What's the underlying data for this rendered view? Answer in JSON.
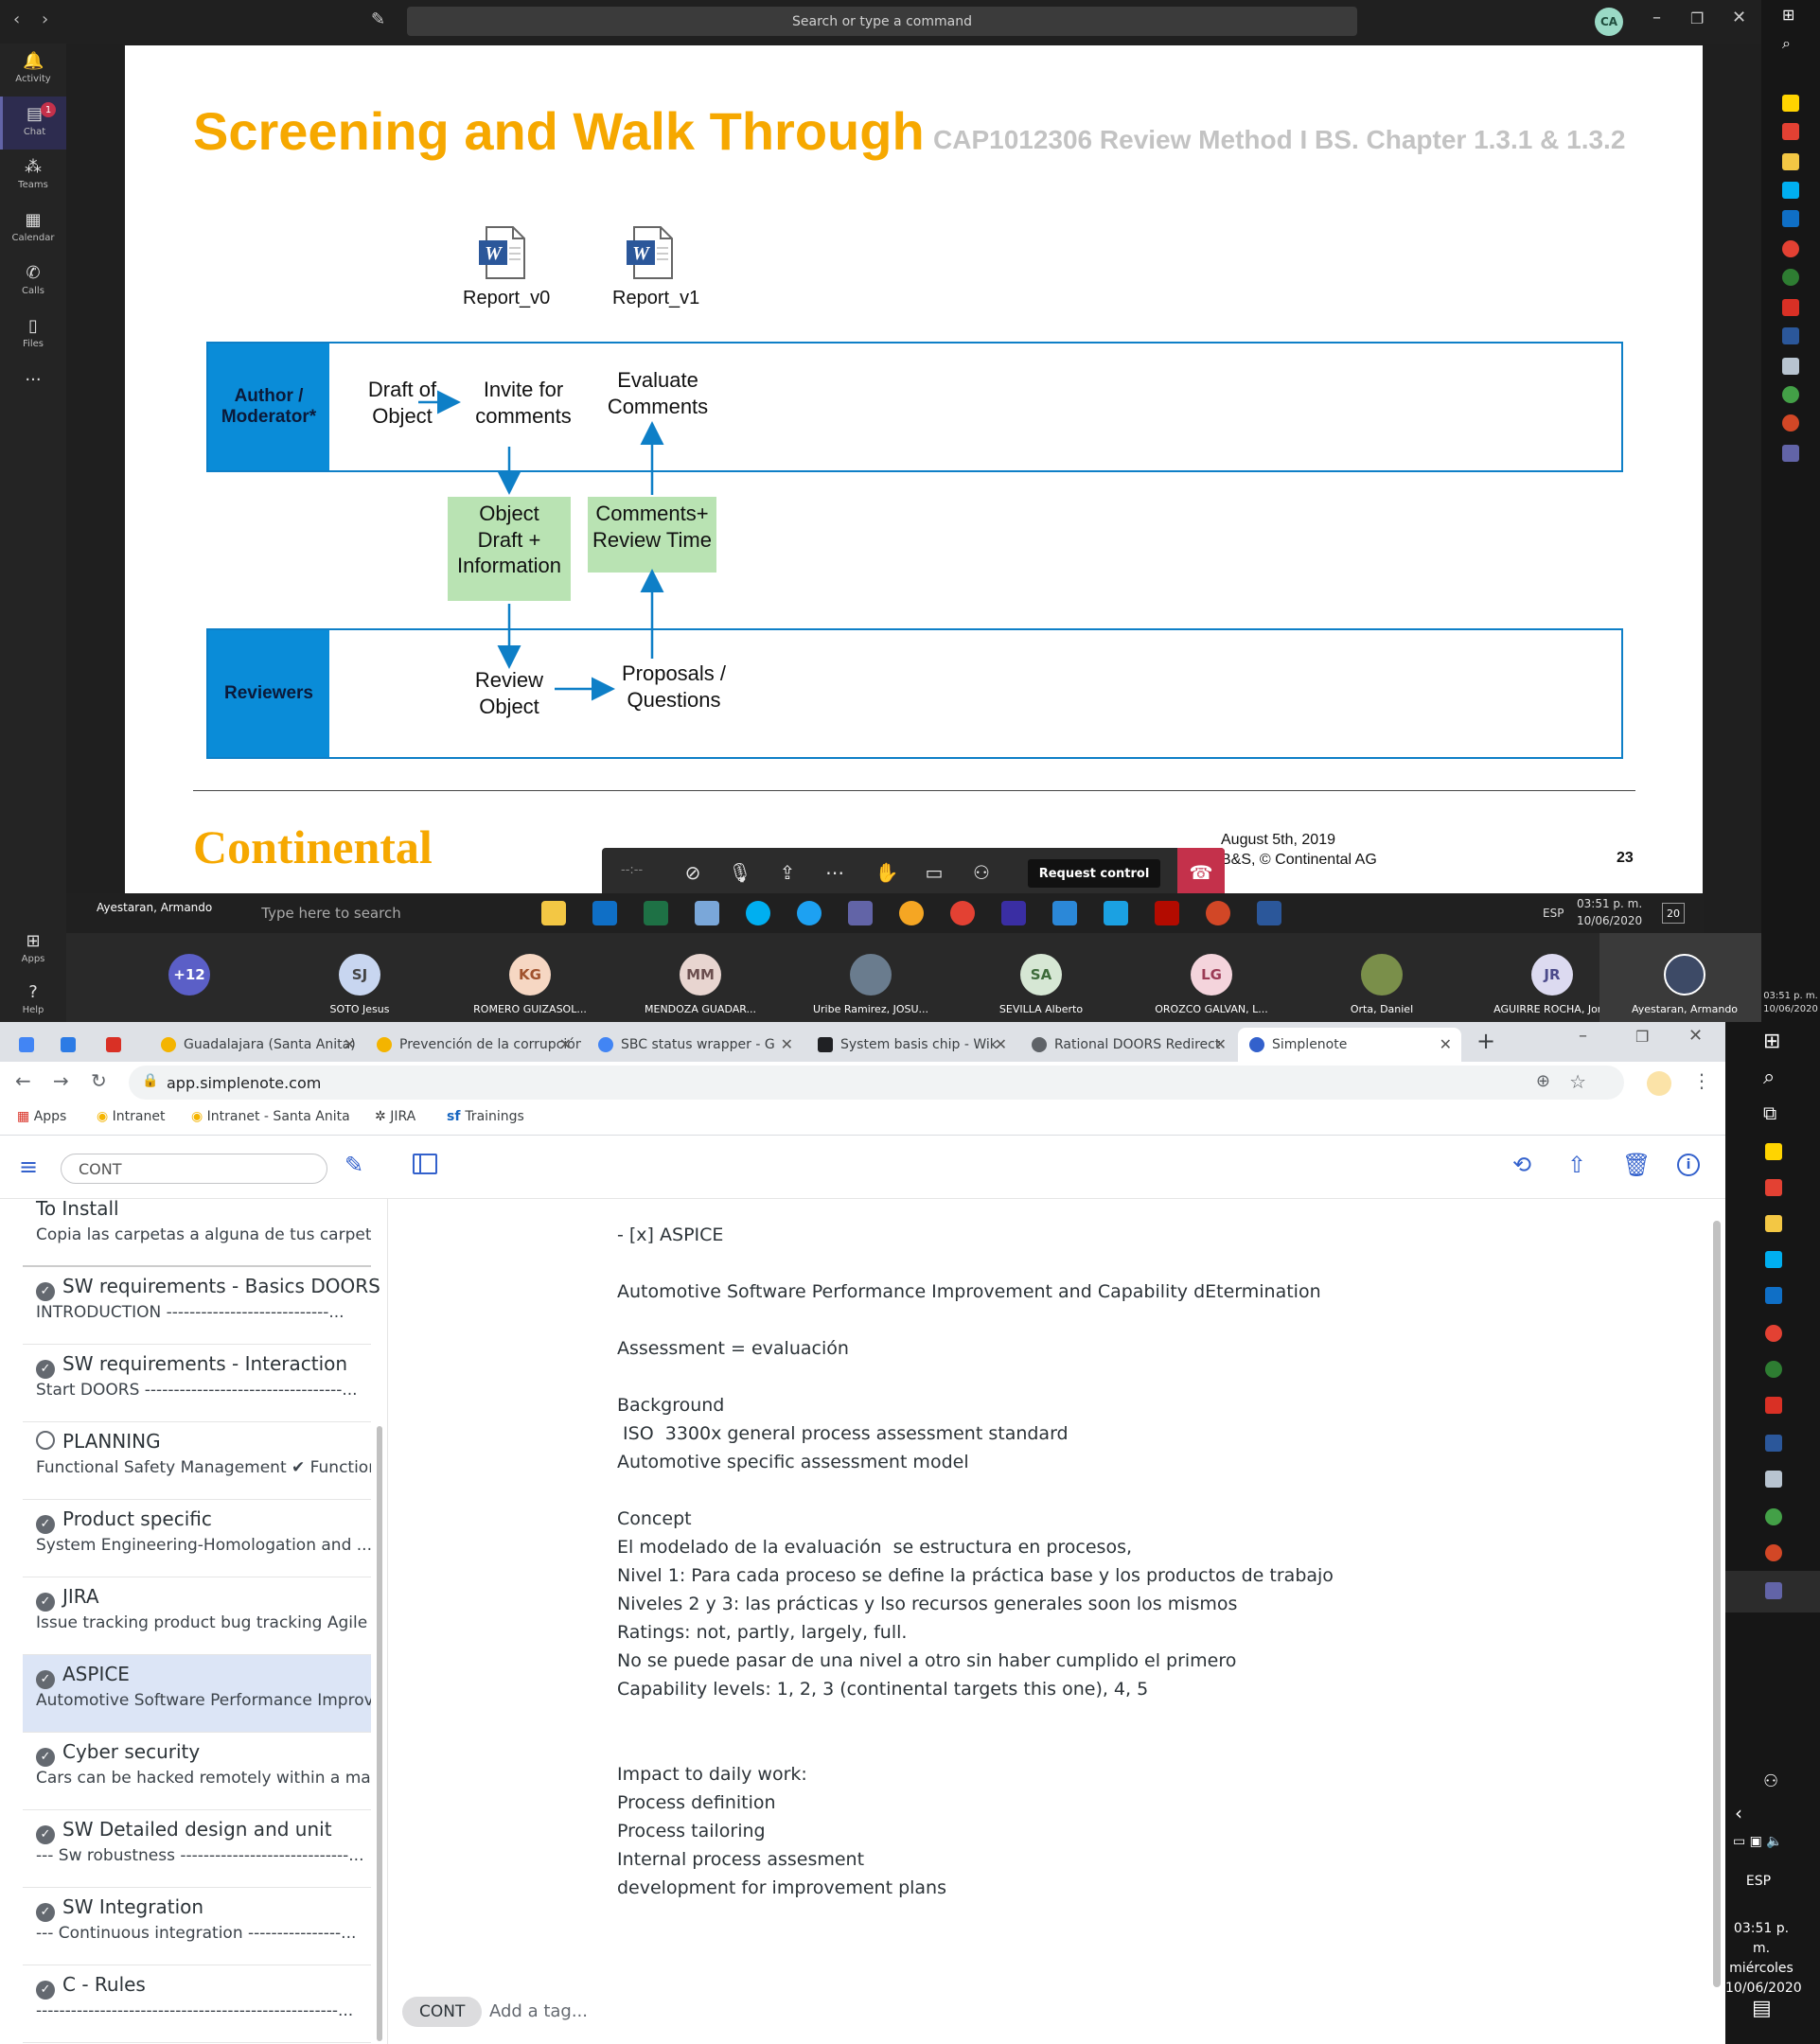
{
  "teams": {
    "search_placeholder": "Search or type a command",
    "user_initials": "CA",
    "rail": [
      {
        "label": "Activity",
        "icon": "bell-icon"
      },
      {
        "label": "Chat",
        "icon": "chat-icon",
        "badge": "1"
      },
      {
        "label": "Teams",
        "icon": "teams-icon"
      },
      {
        "label": "Calendar",
        "icon": "calendar-icon"
      },
      {
        "label": "Calls",
        "icon": "phone-icon"
      },
      {
        "label": "Files",
        "icon": "file-icon"
      },
      {
        "label": "...",
        "icon": "more-icon"
      }
    ],
    "rail_bottom": [
      {
        "label": "Apps",
        "icon": "apps-icon"
      },
      {
        "label": "Help",
        "icon": "help-icon"
      }
    ],
    "call_controls": {
      "timer": "--:--",
      "request_control": "Request control"
    },
    "participants": [
      {
        "initials": "+12",
        "name": "",
        "color": "#5b5fc7"
      },
      {
        "initials": "SJ",
        "name": "SOTO Jesus",
        "color": "#c8d6f0"
      },
      {
        "initials": "KG",
        "name": "ROMERO GUIZASOL...",
        "color": "#f6d7c3"
      },
      {
        "initials": "MM",
        "name": "MENDOZA GUADAR...",
        "color": "#e8d5d0"
      },
      {
        "initials": "",
        "name": "Uribe Ramirez, JOSU...",
        "color": "#6a7c8e"
      },
      {
        "initials": "SA",
        "name": "SEVILLA Alberto",
        "color": "#d6e7d4"
      },
      {
        "initials": "LG",
        "name": "OROZCO GALVAN, L...",
        "color": "#f4d4dc"
      },
      {
        "initials": "",
        "name": "Orta, Daniel",
        "color": "#7a8f4a"
      },
      {
        "initials": "JR",
        "name": "AGUIRRE ROCHA, Jor...",
        "color": "#dcdaf0"
      },
      {
        "initials": "",
        "name": "Ayestaran, Armando",
        "color": "#3d4a66"
      }
    ]
  },
  "slide": {
    "title": "Screening and Walk Through",
    "subtitle": "CAP1012306 Review Method I BS. Chapter 1.3.1 & 1.3.2",
    "docs": [
      "Report_v0",
      "Report_v1"
    ],
    "lane_author": "Author / Moderator*",
    "lane_reviewers": "Reviewers",
    "nodes": {
      "draft": "Draft of\nObject",
      "invite": "Invite for\ncomments",
      "evaluate": "Evaluate\nComments",
      "object_draft": "Object\nDraft +\nInformation",
      "comments_time": "Comments+\nReview Time",
      "review": "Review\nObject",
      "proposals": "Proposals /\nQuestions"
    },
    "logo": "Continental",
    "footer_date": "August 5th, 2019",
    "footer_copy": "B&S, © Continental AG",
    "page": "23"
  },
  "remote_taskbar": {
    "user_label": "Ayestaran, Armando",
    "search_placeholder": "Type here to search",
    "lang": "ESP",
    "time": "03:51 p. m.",
    "date": "10/06/2020",
    "notif": "20"
  },
  "local_tray": {
    "time_top": "03:51 p. m.",
    "date_top": "10/06/2020",
    "lang": "ESP",
    "time": "03:51 p. m.",
    "day": "miércoles",
    "date": "10/06/2020"
  },
  "chrome": {
    "tabs": [
      {
        "title": "",
        "color": "#4285f4"
      },
      {
        "title": "",
        "color": "#2c7be5"
      },
      {
        "title": "",
        "color": "#d93025"
      },
      {
        "title": "Guadalajara (Santa Anita)",
        "color": "#f4b400"
      },
      {
        "title": "Prevención de la corrupción",
        "color": "#f4b400"
      },
      {
        "title": "SBC status wrapper - G",
        "color": "#4285f4"
      },
      {
        "title": "System basis chip - Wik",
        "color": "#202124"
      },
      {
        "title": "Rational DOORS Redirect",
        "color": "#5f6368"
      },
      {
        "title": "Simplenote",
        "color": "#3361cc"
      }
    ],
    "url": "app.simplenote.com",
    "bookmarks": [
      "Apps",
      "Intranet",
      "Intranet - Santa Anita",
      "JIRA",
      "Trainings"
    ]
  },
  "simplenote": {
    "search_value": "CONT",
    "notes": [
      {
        "title": "To Install",
        "preview": "Copia las carpetas a alguna de tus carpetas. ...",
        "check": "none"
      },
      {
        "title": "SW requirements - Basics DOORS",
        "preview": "INTRODUCTION ----------------------------...",
        "check": "done"
      },
      {
        "title": "SW requirements - Interaction",
        "preview": "Start DOORS ----------------------------------...",
        "check": "done"
      },
      {
        "title": "PLANNING",
        "preview": "Functional Safety Management  ✔ Function...",
        "check": "open"
      },
      {
        "title": "Product specific",
        "preview": "System Engineering-Homologation and ...",
        "check": "done"
      },
      {
        "title": "JIRA",
        "preview": "Issue tracking product bug tracking Agile pr...",
        "check": "done"
      },
      {
        "title": "ASPICE",
        "preview": "Automotive Software Performance Improve...",
        "check": "done"
      },
      {
        "title": "Cyber security",
        "preview": "Cars can be hacked remotely within a matte...",
        "check": "done"
      },
      {
        "title": "SW Detailed design and unit",
        "preview": "--- Sw robustness -----------------------------...",
        "check": "done"
      },
      {
        "title": "SW Integration",
        "preview": "--- Continuous integration ----------------...",
        "check": "done"
      },
      {
        "title": "C - Rules",
        "preview": "----------------------------------------------------...",
        "check": "done"
      }
    ],
    "editor_text": "- [x] ASPICE\n\nAutomotive Software Performance Improvement and Capability dEtermination\n\nAssessment = evaluación\n\nBackground\n ISO  3300x general process assessment standard\nAutomotive specific assessment model\n\nConcept\nEl modelado de la evaluación  se estructura en procesos,\nNivel 1: Para cada proceso se define la práctica base y los productos de trabajo\nNiveles 2 y 3: las prácticas y lso recursos generales soon los mismos\nRatings: not, partly, largely, full.\nNo se puede pasar de una nivel a otro sin haber cumplido el primero\nCapability levels: 1, 2, 3 (continental targets this one), 4, 5\n\n\nImpact to daily work:\nProcess definition\nProcess tailoring\nInternal process assesment\ndevelopment for improvement plans",
    "tag": "CONT",
    "tag_placeholder": "Add a tag..."
  }
}
